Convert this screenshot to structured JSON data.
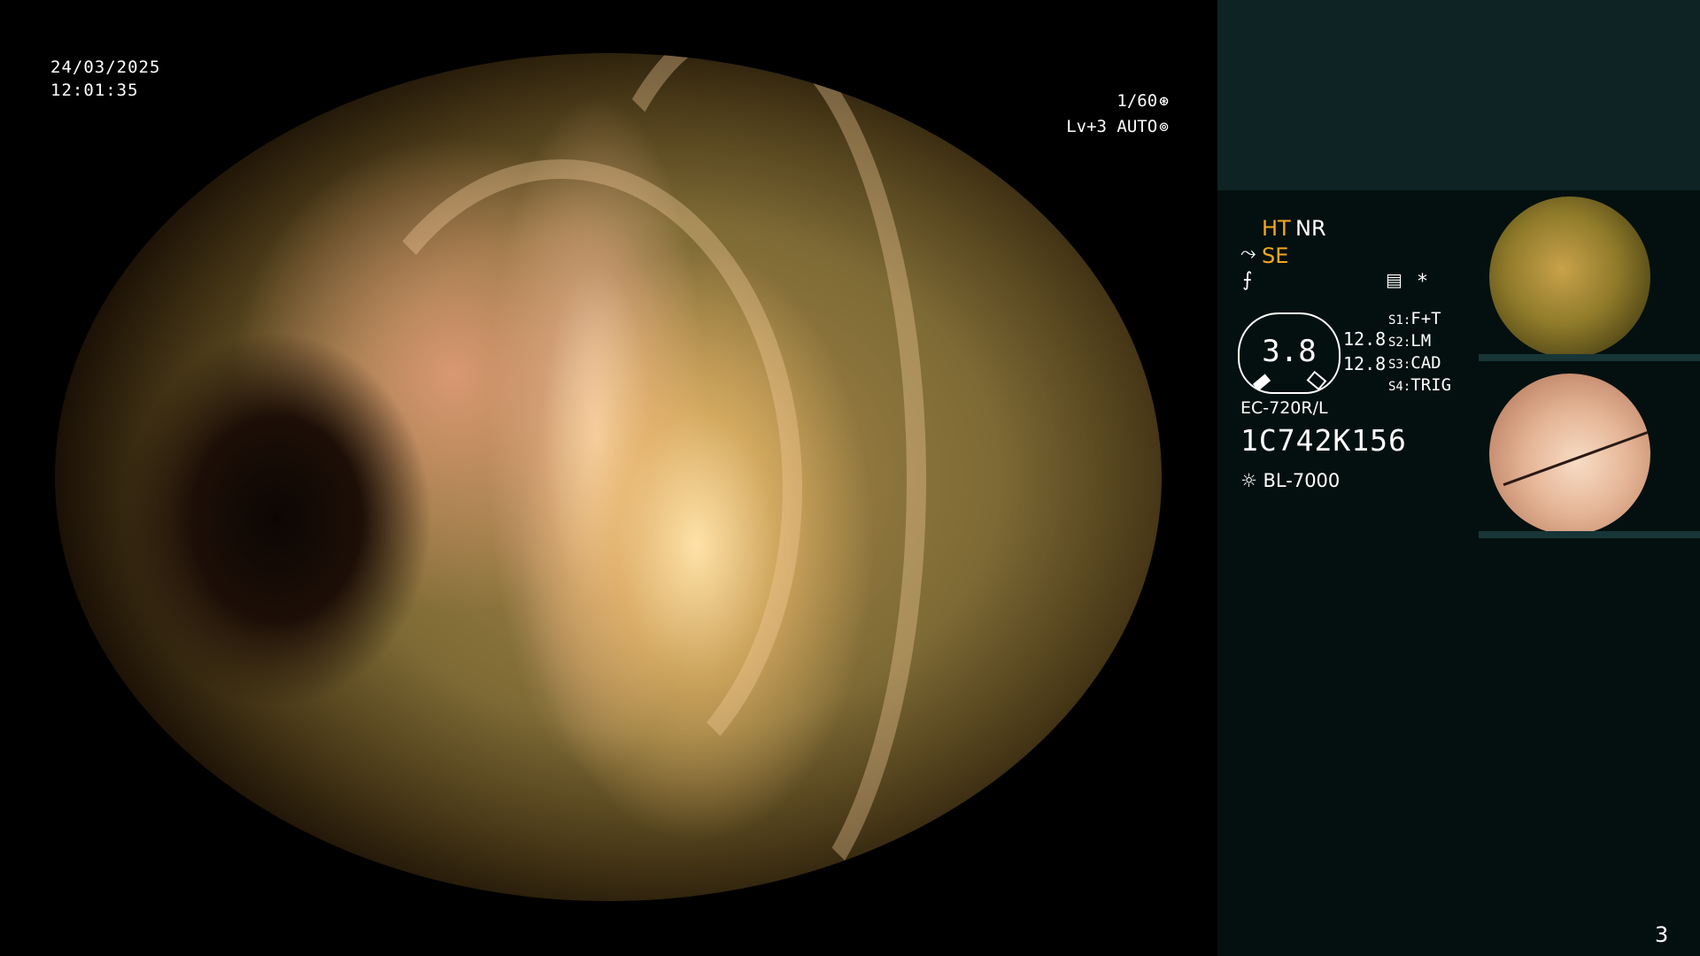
{
  "main": {
    "date": "24/03/2025",
    "time": "12:01:35",
    "shutter": "1/60",
    "shutter_icon": "aperture-icon",
    "level": "Lv+3 AUTO",
    "level_icon": "iris-icon"
  },
  "side": {
    "ht": "HT",
    "nr": "NR",
    "se": "SE",
    "structure_icon": "structure-enhance-icon",
    "color_icon": "color-mode-icon",
    "menu_icon": "memory-icon",
    "asterisk": "*",
    "gauge_value": "3.8",
    "gauge_side_1": "12.8",
    "gauge_side_2": "12.8",
    "scope_switches": [
      {
        "key": "S1:",
        "value": "F+T"
      },
      {
        "key": "S2:",
        "value": "LM"
      },
      {
        "key": "S3:",
        "value": "CAD"
      },
      {
        "key": "S4:",
        "value": "TRIG"
      }
    ],
    "scope_model": "EC-720R/L",
    "scope_serial": "1C742K156",
    "light_source_icon": "lamp-icon",
    "light_source": "BL-7000"
  },
  "page_number": "3",
  "colors": {
    "accent_orange": "#f2a91e",
    "side_panel_bg": "#04100f",
    "side_top_bg": "#0e2324"
  }
}
